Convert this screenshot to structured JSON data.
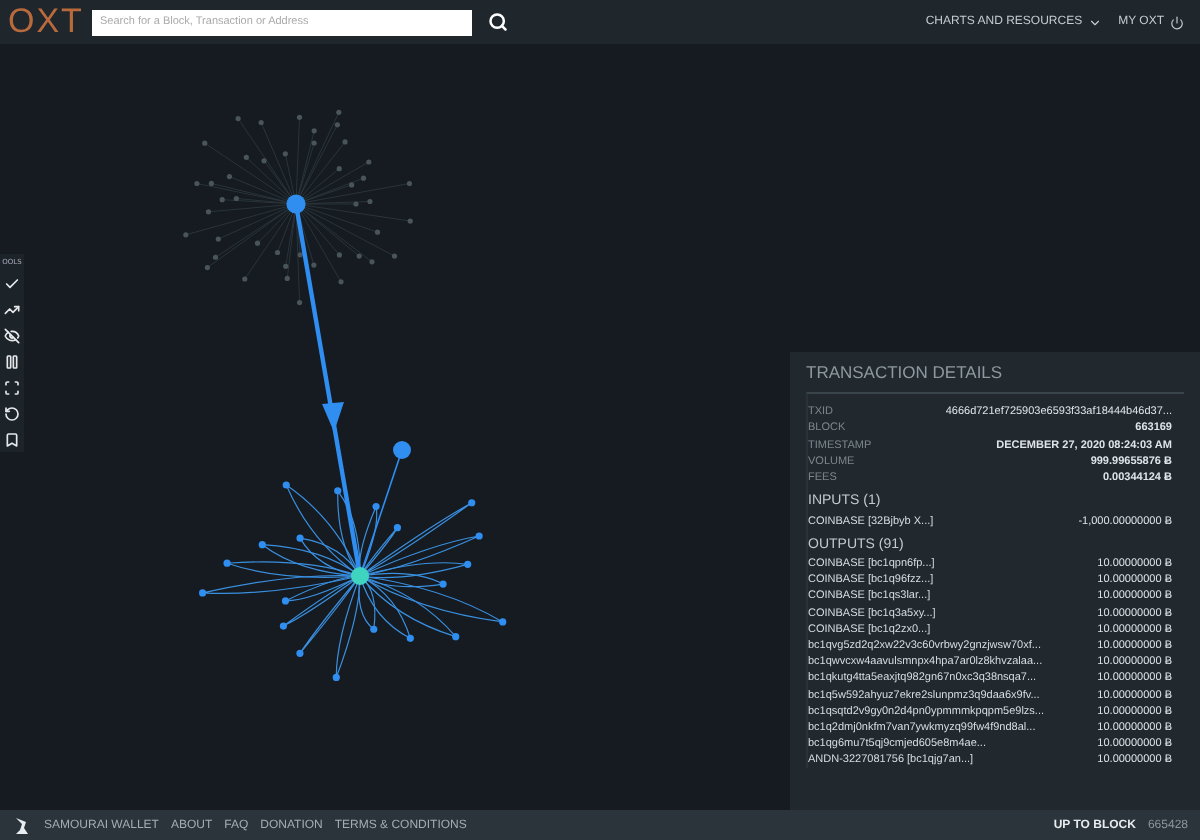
{
  "header": {
    "logo": "OXT",
    "search": {
      "placeholder": "Search for a Block, Transaction or Address"
    },
    "menu": [
      {
        "label": "CHARTS AND RESOURCES",
        "kind": "dropdown"
      },
      {
        "label": "MY OXT",
        "kind": "power"
      }
    ]
  },
  "tools": {
    "label": "OOLS",
    "items": [
      {
        "kind": "check"
      },
      {
        "kind": "trend"
      },
      {
        "kind": "hide"
      },
      {
        "kind": "pause"
      },
      {
        "kind": "fit"
      },
      {
        "kind": "undo"
      },
      {
        "kind": "bookmark"
      }
    ]
  },
  "details": {
    "title": "TRANSACTION DETAILS",
    "fields": [
      {
        "label": "TXID",
        "value": "4666d721ef725903e6593f33af18444b46d37..."
      },
      {
        "label": "BLOCK",
        "value": "663169"
      },
      {
        "label": "TIMESTAMP",
        "value": "DECEMBER 27, 2020 08:24:03 AM"
      },
      {
        "label": "VOLUME",
        "value": "999.99655876 Ƀ"
      },
      {
        "label": "FEES",
        "value": "0.00344124 Ƀ"
      }
    ],
    "inputs": {
      "title": "INPUTS (1)",
      "rows": [
        {
          "address": "COINBASE [32Bjbyb X...]",
          "amount": "-1,000.00000000 Ƀ"
        }
      ]
    },
    "outputs": {
      "title": "OUTPUTS (91)",
      "rows": [
        {
          "address": "COINBASE [bc1qpn6fp...]",
          "amount": "10.00000000 Ƀ"
        },
        {
          "address": "COINBASE [bc1q96fzz...]",
          "amount": "10.00000000 Ƀ"
        },
        {
          "address": "COINBASE [bc1qs3lar...]",
          "amount": "10.00000000 Ƀ"
        },
        {
          "address": "COINBASE [bc1q3a5xy...]",
          "amount": "10.00000000 Ƀ"
        },
        {
          "address": "COINBASE [bc1q2zx0...]",
          "amount": "10.00000000 Ƀ"
        },
        {
          "address": "bc1qvg5zd2q2xw22v3c60vrbwy2gnzjwsw70xf...",
          "amount": "10.00000000 Ƀ"
        },
        {
          "address": "bc1qwvcxw4aavulsmnpx4hpa7ar0lz8khvzalaa...",
          "amount": "10.00000000 Ƀ"
        },
        {
          "address": "bc1qkutg4tta5eaxjtq982gn67n0xc3q38nsqa7...",
          "amount": "10.00000000 Ƀ"
        },
        {
          "address": "bc1q5w592ahyuz7ekre2slunpmz3q9daa6x9fv...",
          "amount": "10.00000000 Ƀ"
        },
        {
          "address": "bc1qsqtd2v9gy0n2d4pn0ypmmmkpqpm5e9lzs...",
          "amount": "10.00000000 Ƀ"
        },
        {
          "address": "bc1q2dmj0nkfm7van7ywkmyzq99fw4f9nd8al...",
          "amount": "10.00000000 Ƀ"
        },
        {
          "address": "bc1qg6mu7t5qj9cmjed605e8m4ae...",
          "amount": "10.00000000 Ƀ"
        },
        {
          "address": "ANDN-3227081756 [bc1qjg7an...]",
          "amount": "10.00000000 Ƀ"
        }
      ]
    }
  },
  "footer": {
    "links": [
      "SAMOURAI WALLET",
      "ABOUT",
      "FAQ",
      "DONATION",
      "TERMS & CONDITIONS"
    ],
    "block_label": "UP TO BLOCK",
    "block_value": "665428"
  }
}
